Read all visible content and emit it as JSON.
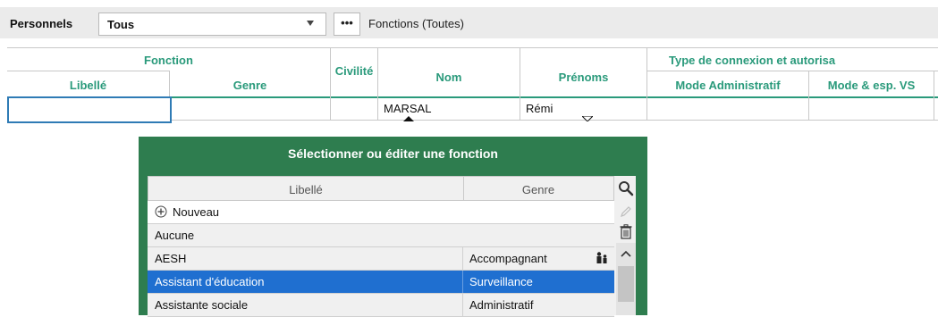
{
  "toolbar": {
    "personnels_label": "Personnels",
    "staff_select_value": "Tous",
    "more_button": "•••",
    "function_filter": "Fonctions (Toutes)"
  },
  "grid": {
    "group_fonction": "Fonction",
    "col_libelle": "Libellé",
    "col_genre": "Genre",
    "col_civilite": "Civilité",
    "col_nom": "Nom",
    "col_prenoms": "Prénoms",
    "group_connexion": "Type de connexion et autorisa",
    "col_mode_admin": "Mode Administratif",
    "col_mode_vs": "Mode & esp. VS",
    "row": {
      "libelle": "",
      "genre": "",
      "civilite": "",
      "nom": "MARSAL",
      "prenoms": "Rémi"
    }
  },
  "dialog": {
    "title": "Sélectionner ou éditer une fonction",
    "col_libelle": "Libellé",
    "col_genre": "Genre",
    "new_label": "Nouveau",
    "rows": [
      {
        "libelle": "Aucune",
        "genre": ""
      },
      {
        "libelle": "AESH",
        "genre": "Accompagnant"
      },
      {
        "libelle": "Assistant d'éducation",
        "genre": "Surveillance"
      },
      {
        "libelle": "Assistante sociale",
        "genre": "Administratif"
      }
    ]
  },
  "colors": {
    "accent_green": "#2e7d4f",
    "header_teal": "#2a9a7b",
    "selection_blue": "#1f6fd0"
  }
}
